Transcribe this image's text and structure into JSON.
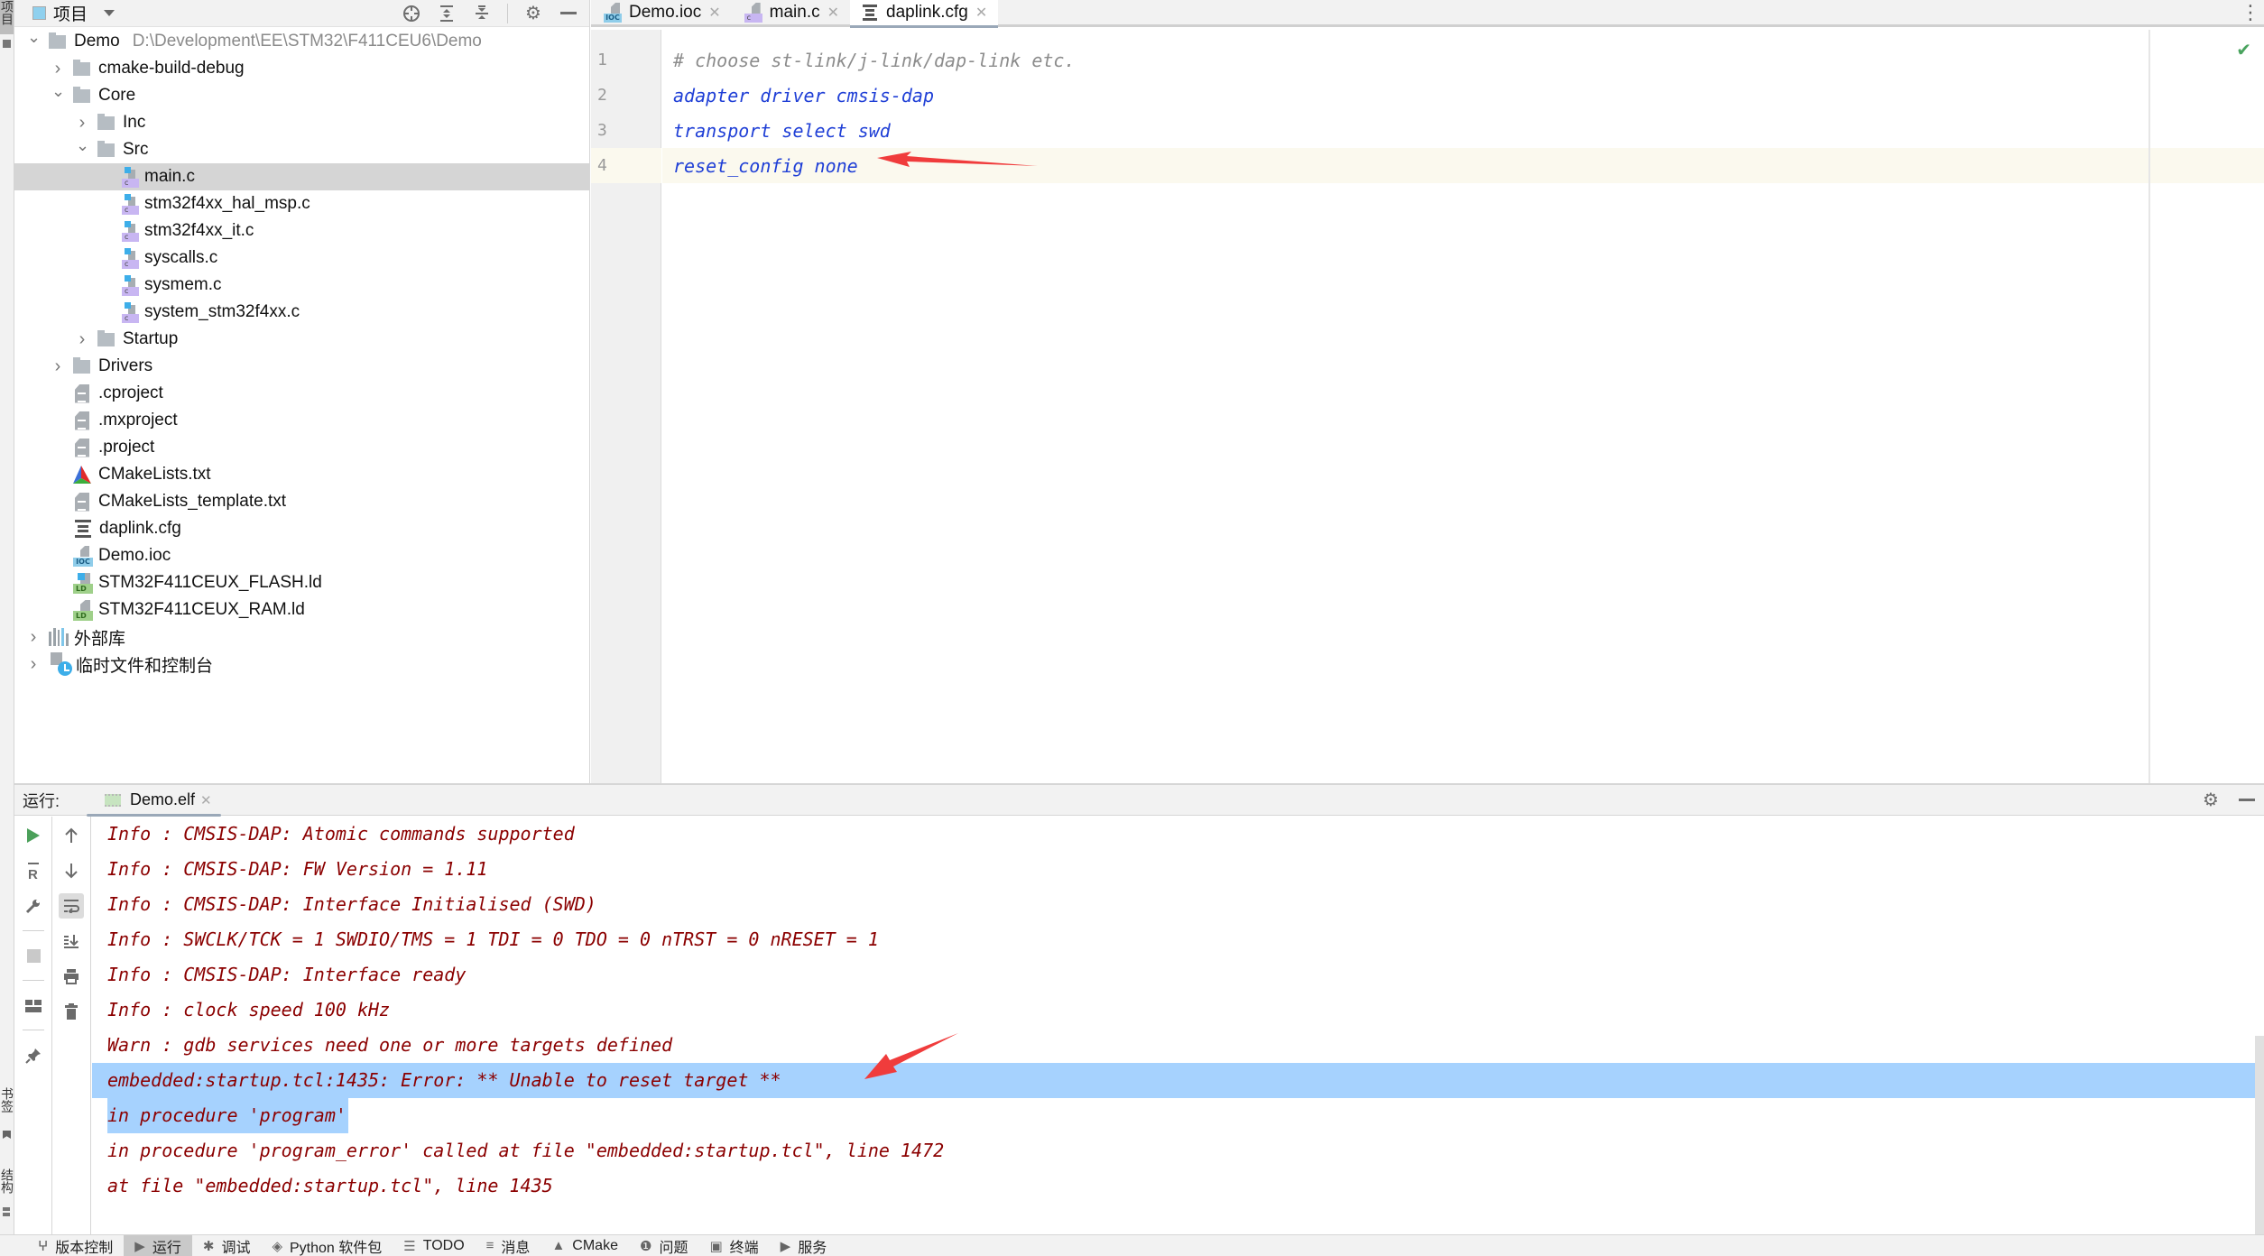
{
  "side_strip": {
    "top_tab": "项目",
    "bottom_tabs": [
      "书签",
      "结构"
    ]
  },
  "project_panel": {
    "title": "项目",
    "tools": [
      "locate-icon",
      "expand-all-icon",
      "collapse-all-icon",
      "gear-icon",
      "minimize-icon"
    ],
    "tree": [
      {
        "label": "Demo",
        "hint": "D:\\Development\\EE\\STM32\\F411CEU6\\Demo",
        "type": "folder",
        "depth": 0,
        "expanded": true
      },
      {
        "label": "cmake-build-debug",
        "type": "folder",
        "depth": 1,
        "expanded": false
      },
      {
        "label": "Core",
        "type": "folder",
        "depth": 1,
        "expanded": true
      },
      {
        "label": "Inc",
        "type": "folder",
        "depth": 2,
        "expanded": false
      },
      {
        "label": "Src",
        "type": "folder",
        "depth": 2,
        "expanded": true
      },
      {
        "label": "main.c",
        "type": "c",
        "depth": 3,
        "selected": true
      },
      {
        "label": "stm32f4xx_hal_msp.c",
        "type": "c",
        "depth": 3
      },
      {
        "label": "stm32f4xx_it.c",
        "type": "c",
        "depth": 3
      },
      {
        "label": "syscalls.c",
        "type": "c",
        "depth": 3
      },
      {
        "label": "sysmem.c",
        "type": "c",
        "depth": 3
      },
      {
        "label": "system_stm32f4xx.c",
        "type": "c",
        "depth": 3
      },
      {
        "label": "Startup",
        "type": "folder",
        "depth": 2,
        "expanded": false
      },
      {
        "label": "Drivers",
        "type": "folder",
        "depth": 1,
        "expanded": false
      },
      {
        "label": ".cproject",
        "type": "text",
        "depth": 1
      },
      {
        "label": ".mxproject",
        "type": "text",
        "depth": 1
      },
      {
        "label": ".project",
        "type": "text",
        "depth": 1
      },
      {
        "label": "CMakeLists.txt",
        "type": "cmake",
        "depth": 1
      },
      {
        "label": "CMakeLists_template.txt",
        "type": "text",
        "depth": 1
      },
      {
        "label": "daplink.cfg",
        "type": "cfg",
        "depth": 1
      },
      {
        "label": "Demo.ioc",
        "type": "ioc",
        "depth": 1
      },
      {
        "label": "STM32F411CEUX_FLASH.ld",
        "type": "ld",
        "depth": 1
      },
      {
        "label": "STM32F411CEUX_RAM.ld",
        "type": "ld-plain",
        "depth": 1
      },
      {
        "label": "外部库",
        "type": "lib",
        "depth": 0,
        "expanded": false
      },
      {
        "label": "临时文件和控制台",
        "type": "scratch",
        "depth": 0,
        "expanded": false
      }
    ]
  },
  "editor": {
    "tabs": [
      {
        "label": "Demo.ioc",
        "icon": "ioc",
        "active": false
      },
      {
        "label": "main.c",
        "icon": "c",
        "active": false
      },
      {
        "label": "daplink.cfg",
        "icon": "cfg",
        "active": true
      }
    ],
    "lines": [
      {
        "num": "1",
        "text": "# choose st-link/j-link/dap-link etc.",
        "kind": "comment"
      },
      {
        "num": "2",
        "text": "adapter driver cmsis-dap",
        "kind": "code"
      },
      {
        "num": "3",
        "text": "transport select swd",
        "kind": "code"
      },
      {
        "num": "4",
        "text": "reset_config none",
        "kind": "code",
        "current": true
      }
    ],
    "inspection_status": "ok"
  },
  "run_panel": {
    "label": "运行:",
    "tab_label": "Demo.elf",
    "console_lines": [
      {
        "text": "Info : CMSIS-DAP: Atomic commands supported"
      },
      {
        "text": "Info : CMSIS-DAP: FW Version = 1.11"
      },
      {
        "text": "Info : CMSIS-DAP: Interface Initialised (SWD)"
      },
      {
        "text": "Info : SWCLK/TCK = 1 SWDIO/TMS = 1 TDI = 0 TDO = 0 nTRST = 0 nRESET = 1"
      },
      {
        "text": "Info : CMSIS-DAP: Interface ready"
      },
      {
        "text": "Info : clock speed 100 kHz"
      },
      {
        "text": "Warn : gdb services need one or more targets defined"
      },
      {
        "text": "embedded:startup.tcl:1435: Error: ** Unable to reset target **",
        "selection": "full"
      },
      {
        "text": "in procedure 'program'",
        "selection": "partial"
      },
      {
        "text": "in procedure 'program_error' called at file \"embedded:startup.tcl\", line 1472"
      },
      {
        "text": "at file \"embedded:startup.tcl\", line 1435"
      }
    ]
  },
  "bottom_bar": {
    "items": [
      {
        "label": "版本控制",
        "icon": "vcs-icon",
        "glyph": "ⵖ"
      },
      {
        "label": "运行",
        "icon": "run-icon",
        "glyph": "▶",
        "active": true
      },
      {
        "label": "调试",
        "icon": "debug-icon",
        "glyph": "✱"
      },
      {
        "label": "Python 软件包",
        "icon": "python-packages-icon",
        "glyph": "◈"
      },
      {
        "label": "TODO",
        "icon": "todo-icon",
        "glyph": "☰"
      },
      {
        "label": "消息",
        "icon": "messages-icon",
        "glyph": "≡"
      },
      {
        "label": "CMake",
        "icon": "cmake-icon",
        "glyph": "▲"
      },
      {
        "label": "问题",
        "icon": "problems-icon",
        "glyph": "❶"
      },
      {
        "label": "终端",
        "icon": "terminal-icon",
        "glyph": "▣"
      },
      {
        "label": "服务",
        "icon": "services-icon",
        "glyph": "▶"
      }
    ]
  },
  "colors": {
    "code_keyword": "#1f3fd6",
    "code_comment": "#8c8c8c",
    "console_text": "#8b0000",
    "selection": "#a6d2fe",
    "current_line": "#fbf9ee",
    "annotation_arrow": "#f03c3c",
    "inspection_ok": "#49a35e"
  }
}
